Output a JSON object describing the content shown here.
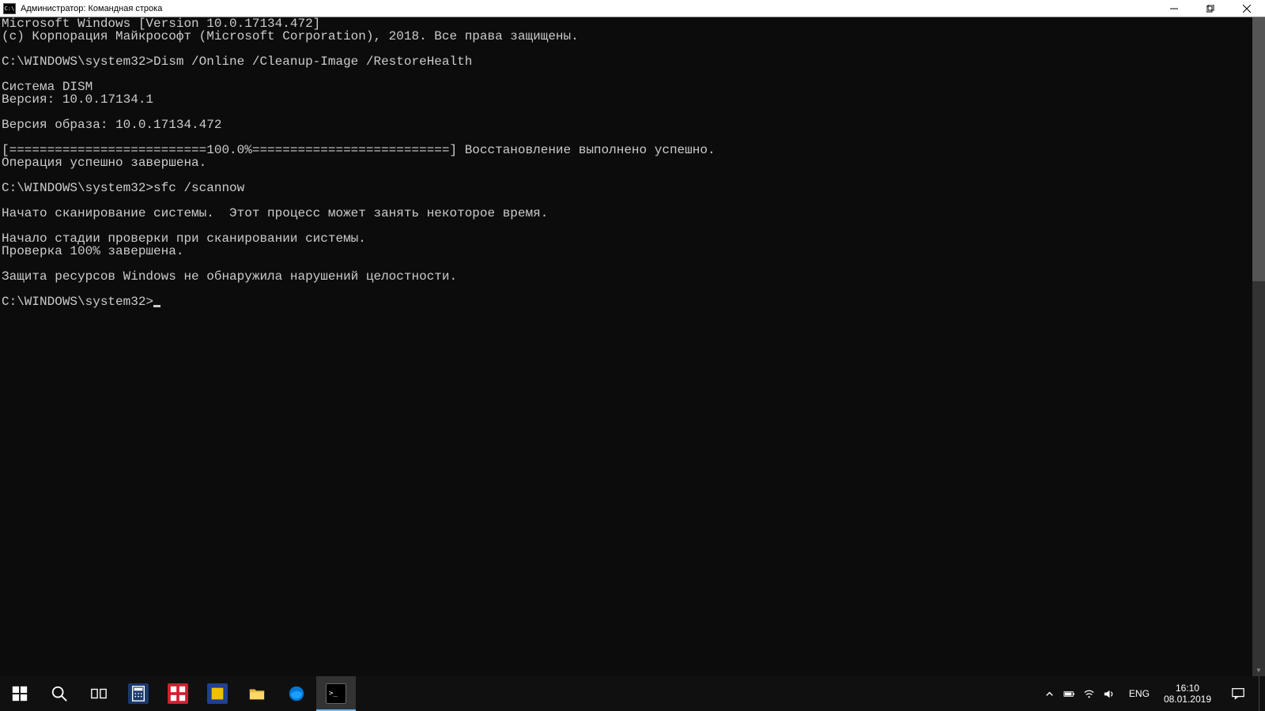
{
  "window": {
    "title": "Администратор: Командная строка",
    "icon_label": "C:\\"
  },
  "terminal": {
    "lines": [
      "Microsoft Windows [Version 10.0.17134.472]",
      "(c) Корпорация Майкрософт (Microsoft Corporation), 2018. Все права защищены.",
      "",
      "C:\\WINDOWS\\system32>Dism /Online /Cleanup-Image /RestoreHealth",
      "",
      "Cистема DISM",
      "Версия: 10.0.17134.1",
      "",
      "Версия образа: 10.0.17134.472",
      "",
      "[==========================100.0%==========================] Восстановление выполнено успешно.",
      "Операция успешно завершена.",
      "",
      "C:\\WINDOWS\\system32>sfc /scannow",
      "",
      "Начато сканирование системы.  Этот процесс может занять некоторое время.",
      "",
      "Начало стадии проверки при сканировании системы.",
      "Проверка 100% завершена.",
      "",
      "Защита ресурсов Windows не обнаружила нарушений целостности.",
      ""
    ],
    "prompt": "C:\\WINDOWS\\system32>"
  },
  "taskbar": {
    "language": "ENG",
    "time": "16:10",
    "date": "08.01.2019"
  }
}
